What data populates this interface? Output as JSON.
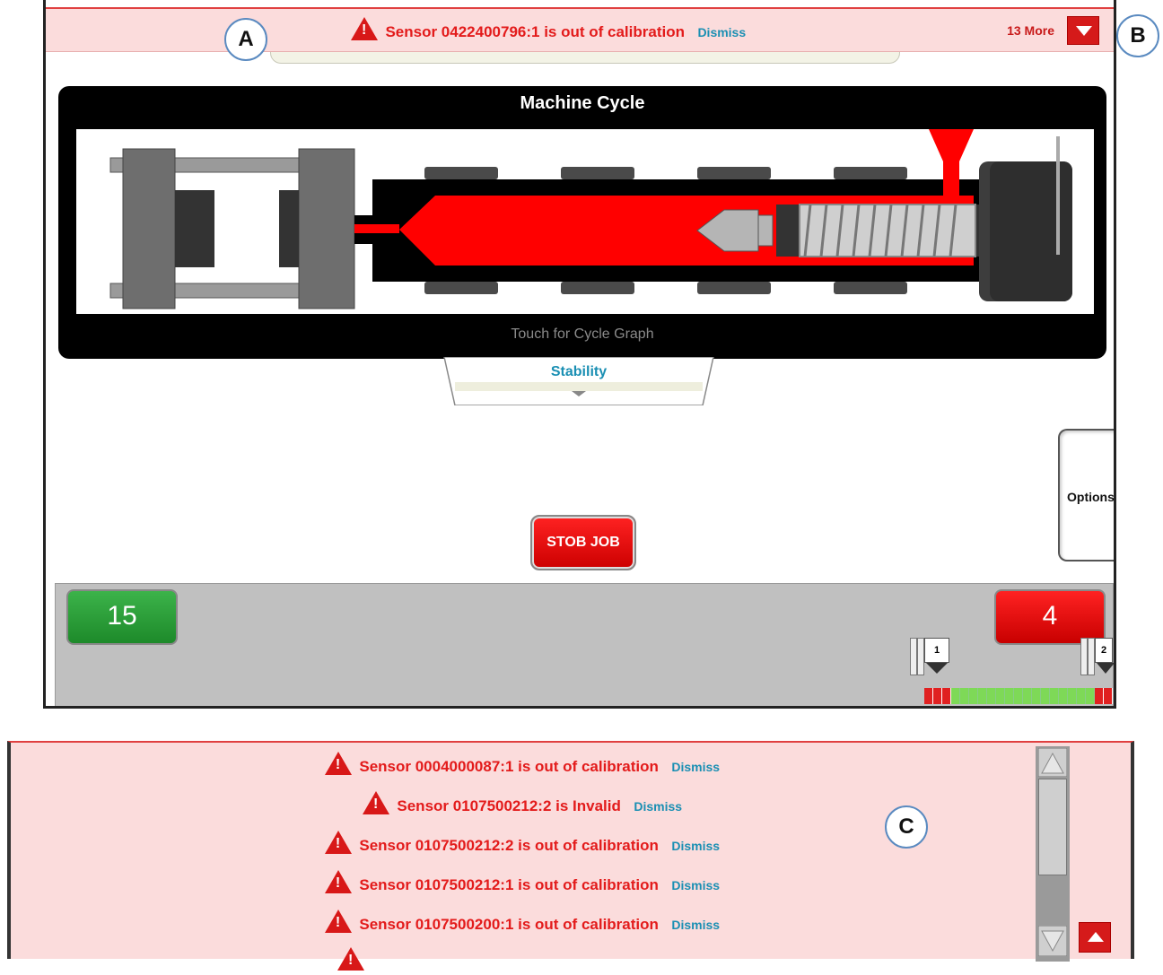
{
  "top_alert": {
    "message": "Sensor 0422400796:1 is out of calibration",
    "dismiss_label": "Dismiss",
    "more_label": "13 More"
  },
  "machine_cycle": {
    "title": "Machine Cycle",
    "hint": "Touch for Cycle Graph"
  },
  "stability_tab": {
    "label": "Stability"
  },
  "options_tab": {
    "label": "Options"
  },
  "stop_button": {
    "label": "STOB JOB"
  },
  "counters": {
    "good": "15",
    "bad": "4",
    "cavity_markers": [
      "1",
      "2"
    ]
  },
  "callouts": {
    "a": "A",
    "b": "B",
    "c": "C"
  },
  "alert_list": [
    {
      "message": "Sensor 0004000087:1 is out of calibration",
      "dismiss": "Dismiss"
    },
    {
      "message": "Sensor 0107500212:2 is Invalid",
      "dismiss": "Dismiss"
    },
    {
      "message": "Sensor 0107500212:2 is out of calibration",
      "dismiss": "Dismiss"
    },
    {
      "message": "Sensor 0107500212:1 is out of calibration",
      "dismiss": "Dismiss"
    },
    {
      "message": "Sensor 0107500200:1 is out of calibration",
      "dismiss": "Dismiss"
    }
  ],
  "colors": {
    "alert_background": "#fbdcdc",
    "alert_text": "#e31b1b",
    "dismiss_link": "#1a8fb3",
    "good_count": "#2a9d38",
    "bad_count": "#e00000"
  }
}
